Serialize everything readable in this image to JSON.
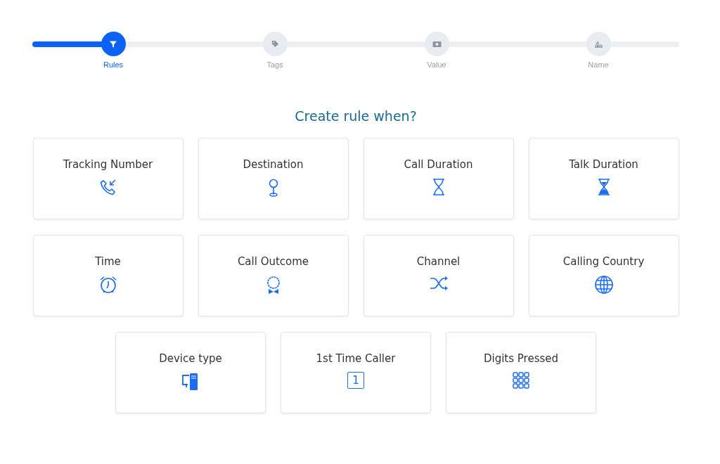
{
  "steps": [
    {
      "label": "Rules",
      "kind": "filter",
      "selected": true
    },
    {
      "label": "Tags",
      "kind": "tag",
      "selected": false
    },
    {
      "label": "Value",
      "kind": "money",
      "selected": false
    },
    {
      "label": "Name",
      "kind": "signature",
      "selected": false
    }
  ],
  "heading": "Create rule when?",
  "cards": [
    {
      "label": "Tracking Number",
      "kind": "phone-in"
    },
    {
      "label": "Destination",
      "kind": "pin"
    },
    {
      "label": "Call Duration",
      "kind": "hourglass"
    },
    {
      "label": "Talk Duration",
      "kind": "hourglass-filled"
    },
    {
      "label": "Time",
      "kind": "alarm"
    },
    {
      "label": "Call Outcome",
      "kind": "award"
    },
    {
      "label": "Channel",
      "kind": "shuffle"
    },
    {
      "label": "Calling Country",
      "kind": "globe"
    },
    {
      "label": "Device type",
      "kind": "devices"
    },
    {
      "label": "1st Time Caller",
      "kind": "number",
      "badge": "1"
    },
    {
      "label": "Digits Pressed",
      "kind": "keypad"
    }
  ]
}
